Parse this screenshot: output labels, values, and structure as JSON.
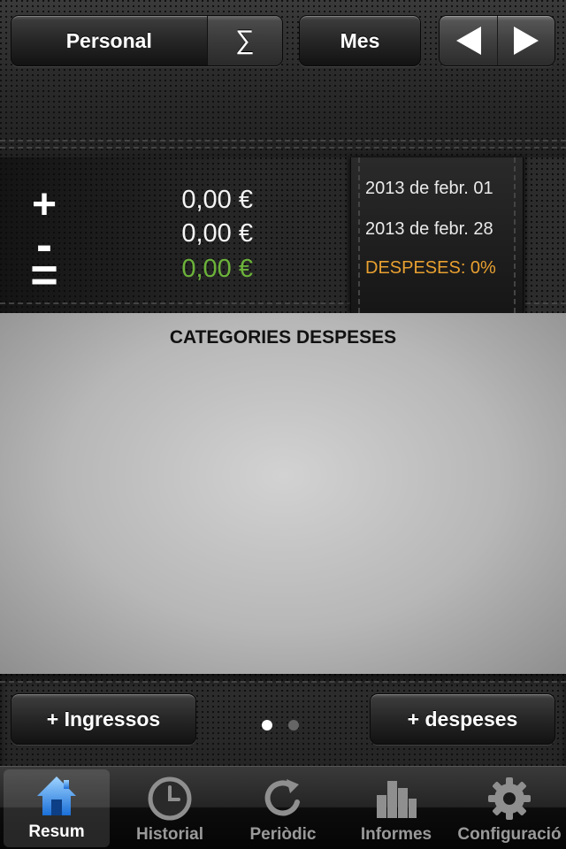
{
  "toolbar": {
    "account_label": "Personal",
    "sum_label": "∑",
    "period_label": "Mes",
    "prev_icon": "arrow-left-icon",
    "next_icon": "arrow-right-icon"
  },
  "summary": {
    "income_symbol": "+",
    "expense_symbol": "-",
    "balance_symbol": "=",
    "income_amount": "0,00 €",
    "expense_amount": "0,00 €",
    "balance_amount": "0,00 €",
    "balance_color": "#6cb33a",
    "start_date": "2013 de febr. 01",
    "end_date": "2013 de febr. 28",
    "expenses_percent": "DESPESES: 0%",
    "expenses_percent_color": "#e8a030"
  },
  "main": {
    "section_title": "CATEGORIES DESPESES"
  },
  "actions": {
    "add_income_label": "+ Ingressos",
    "add_expense_label": "+ despeses",
    "page_count": 2,
    "active_page": 1
  },
  "tabs": [
    {
      "label": "Resum",
      "icon": "home-icon",
      "selected": true
    },
    {
      "label": "Historial",
      "icon": "clock-icon",
      "selected": false
    },
    {
      "label": "Periòdic",
      "icon": "refresh-icon",
      "selected": false
    },
    {
      "label": "Informes",
      "icon": "bar-chart-icon",
      "selected": false
    },
    {
      "label": "Configuració",
      "icon": "gear-icon",
      "selected": false
    }
  ]
}
